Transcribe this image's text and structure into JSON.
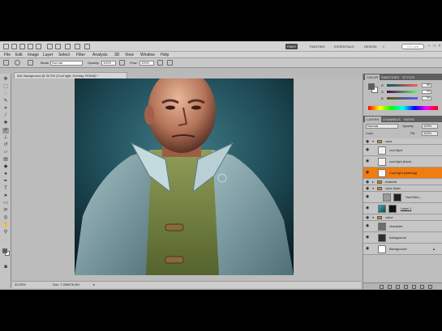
{
  "app_bar": {
    "workspaces": [
      "PAINTING",
      "ESSENTIALS",
      "DESIGN",
      "PAINT"
    ],
    "active_workspace": "PAINT",
    "search_placeholder": "CS Live"
  },
  "menu": [
    "File",
    "Edit",
    "Image",
    "Layer",
    "Select",
    "Filter",
    "Analysis",
    "3D",
    "View",
    "Window",
    "Help"
  ],
  "options_bar": {
    "mode_label": "Mode:",
    "mode_value": "Normal",
    "opacity_label": "Opacity:",
    "opacity_value": "100%",
    "flow_label": "Flow:",
    "flow_value": "100%"
  },
  "document": {
    "tab_title": "WIL Background @ 33.3% (Cool light, Overlay, RGB/8) *",
    "zoom": "33.33%",
    "doc_size": "Doc: 7.25M/76.4M"
  },
  "color_panel": {
    "tabs": [
      "COLOR",
      "SWATCHES",
      "STYLES"
    ],
    "active_tab": "COLOR",
    "channels": [
      {
        "label": "R",
        "value": "88"
      },
      {
        "label": "G",
        "value": "93"
      },
      {
        "label": "B",
        "value": "99"
      }
    ],
    "swatch_colors": {
      "foreground": "#585d63",
      "background": "#ffffff"
    }
  },
  "layers_panel": {
    "tabs": [
      "LAYERS",
      "CHANNELS",
      "PATHS"
    ],
    "active_tab": "LAYERS",
    "blend_mode": "Normal",
    "opacity_label": "Opacity:",
    "opacity_value": "100%",
    "lock_label": "Lock:",
    "fill_label": "Fill:",
    "fill_value": "100%",
    "layers": [
      {
        "name": "color",
        "kind": "group"
      },
      {
        "name": "cool light",
        "kind": "layer",
        "thumb": "#f2f2f2"
      },
      {
        "name": "cool light (face)",
        "kind": "layer",
        "thumb": "#f2f2f2"
      },
      {
        "name": "Cool light (clothing)",
        "kind": "layer",
        "thumb": "#f7f7f7",
        "selected": true
      },
      {
        "name": "material",
        "kind": "group"
      },
      {
        "name": "color basic",
        "kind": "group"
      },
      {
        "name": "Hue/Satu...",
        "kind": "adjustment",
        "thumb": "#222222"
      },
      {
        "name": "Layer 1",
        "kind": "layer",
        "thumb": "#2a7f86"
      },
      {
        "name": "value",
        "kind": "group"
      },
      {
        "name": "character",
        "kind": "layer",
        "thumb": "#6d6d6d"
      },
      {
        "name": "background",
        "kind": "layer",
        "thumb": "#2d2d2d"
      },
      {
        "name": "Background",
        "kind": "layer",
        "thumb": "#ffffff"
      }
    ]
  }
}
